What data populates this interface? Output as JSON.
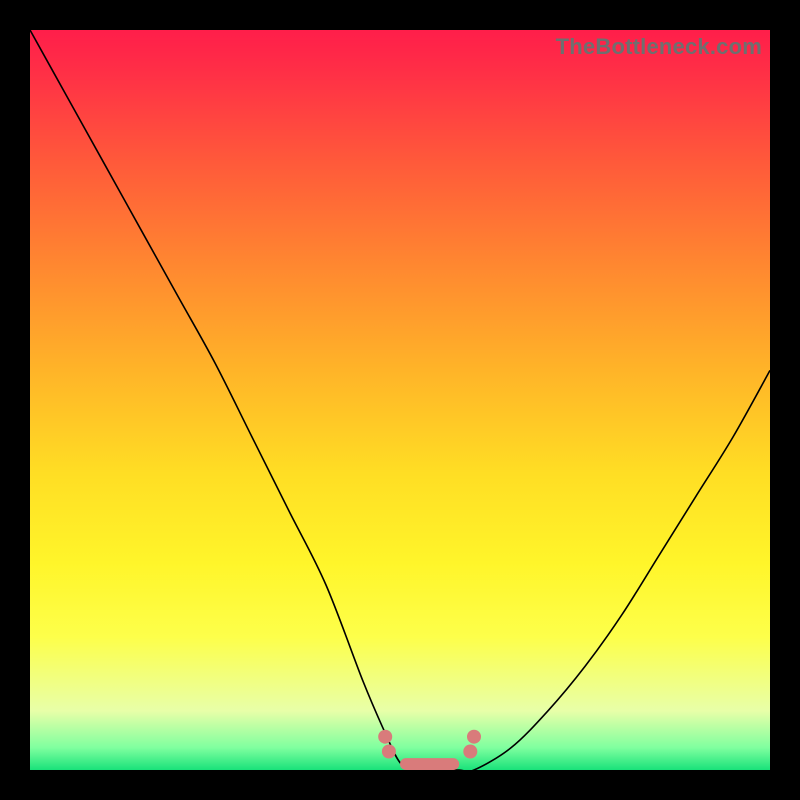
{
  "watermark": "TheBottleneck.com",
  "colors": {
    "background": "#000000",
    "gradient_top": "#ff1e4a",
    "gradient_bottom": "#19e27a",
    "curve": "#000000",
    "markers": "#d97b7b"
  },
  "chart_data": {
    "type": "line",
    "title": "",
    "xlabel": "",
    "ylabel": "",
    "xlim": [
      0,
      100
    ],
    "ylim": [
      0,
      100
    ],
    "grid": false,
    "legend": false,
    "series": [
      {
        "name": "bottleneck-curve",
        "x": [
          0,
          5,
          10,
          15,
          20,
          25,
          30,
          35,
          40,
          45,
          48,
          50,
          52,
          55,
          58,
          60,
          65,
          70,
          75,
          80,
          85,
          90,
          95,
          100
        ],
        "y": [
          100,
          91,
          82,
          73,
          64,
          55,
          45,
          35,
          25,
          12,
          5,
          1,
          0,
          0,
          0,
          0,
          3,
          8,
          14,
          21,
          29,
          37,
          45,
          54
        ]
      }
    ],
    "markers": [
      {
        "name": "left-cluster-top",
        "x": 48,
        "y": 4.5
      },
      {
        "name": "left-cluster-mid",
        "x": 48.5,
        "y": 2.5
      },
      {
        "name": "right-cluster-top",
        "x": 60,
        "y": 4.5
      },
      {
        "name": "right-cluster-mid",
        "x": 59.5,
        "y": 2.5
      },
      {
        "name": "floor-bar",
        "type": "bar",
        "x0": 50,
        "x1": 58,
        "y": 0.4
      }
    ]
  }
}
